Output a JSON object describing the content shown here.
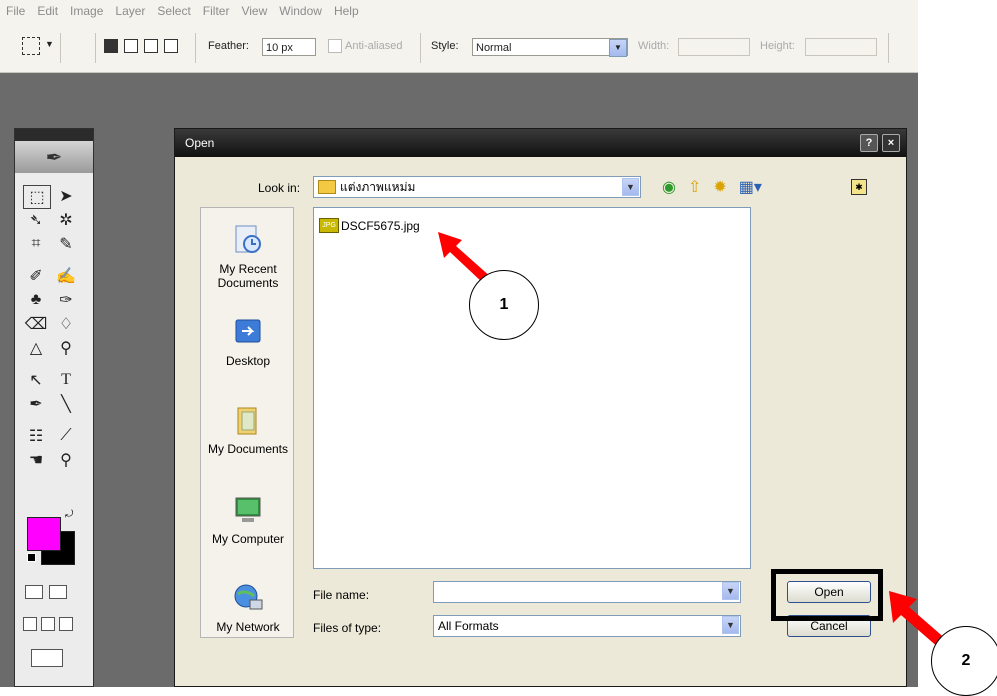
{
  "menu": [
    "File",
    "Edit",
    "Image",
    "Layer",
    "Select",
    "Filter",
    "View",
    "Window",
    "Help"
  ],
  "options": {
    "feather_label": "Feather:",
    "feather_value": "10 px",
    "antialiased_label": "Anti-aliased",
    "style_label": "Style:",
    "style_value": "Normal",
    "width_label": "Width:",
    "height_label": "Height:"
  },
  "dialog": {
    "title": "Open",
    "help_btn": "?",
    "close_btn": "×",
    "look_in_label": "Look in:",
    "look_in_value": "แต่งภาพแหม่ม",
    "places": [
      "My Recent Documents",
      "Desktop",
      "My Documents",
      "My Computer",
      "My Network"
    ],
    "files": [
      "DSCF5675.jpg"
    ],
    "file_name_label": "File name:",
    "file_name_value": "",
    "file_type_label": "Files of type:",
    "file_type_value": "All Formats",
    "open_button": "Open",
    "cancel_button": "Cancel"
  },
  "annotations": {
    "step1": "1",
    "step2": "2"
  },
  "colors": {
    "foreground": "#ff00ff",
    "background": "#000000",
    "arrow": "#ff0000"
  }
}
